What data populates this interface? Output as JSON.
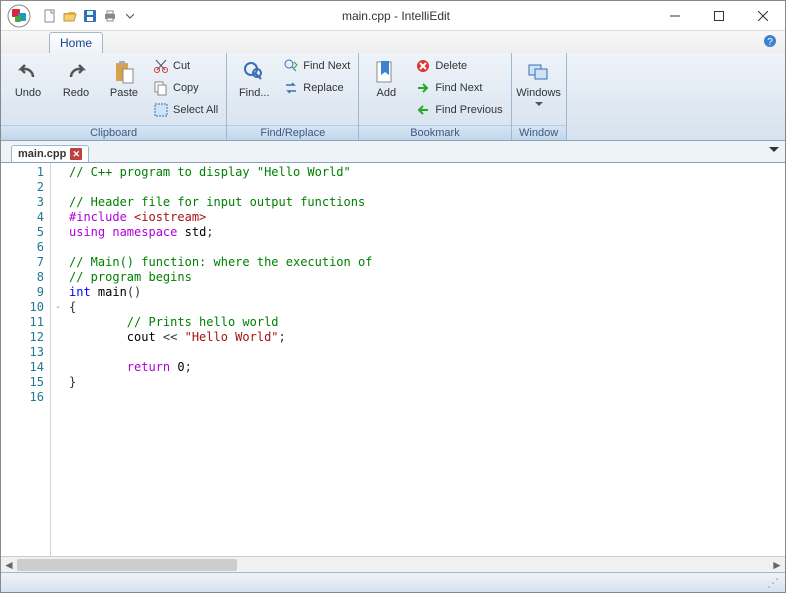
{
  "titlebar": {
    "title": "main.cpp - IntelliEdit"
  },
  "ribbon_tabs": {
    "home": "Home"
  },
  "ribbon": {
    "clipboard": {
      "label": "Clipboard",
      "undo": "Undo",
      "redo": "Redo",
      "paste": "Paste",
      "cut": "Cut",
      "copy": "Copy",
      "select_all": "Select All"
    },
    "find_replace": {
      "label": "Find/Replace",
      "find": "Find...",
      "find_next": "Find Next",
      "replace": "Replace"
    },
    "bookmark": {
      "label": "Bookmark",
      "add": "Add",
      "delete": "Delete",
      "find_next": "Find Next",
      "find_previous": "Find Previous"
    },
    "window": {
      "label": "Window",
      "windows": "Windows"
    }
  },
  "file_tab": {
    "name": "main.cpp"
  },
  "code": {
    "lines": [
      {
        "n": 1,
        "t": "comment",
        "text": "// C++ program to display \"Hello World\""
      },
      {
        "n": 2,
        "t": "blank",
        "text": ""
      },
      {
        "n": 3,
        "t": "comment",
        "text": "// Header file for input output functions"
      },
      {
        "n": 4,
        "t": "include",
        "text": "#include <iostream>"
      },
      {
        "n": 5,
        "t": "using",
        "text": "using namespace std;"
      },
      {
        "n": 6,
        "t": "blank",
        "text": ""
      },
      {
        "n": 7,
        "t": "comment",
        "text": "// Main() function: where the execution of"
      },
      {
        "n": 8,
        "t": "comment",
        "text": "// program begins"
      },
      {
        "n": 9,
        "t": "main_sig",
        "text": "int main()"
      },
      {
        "n": 10,
        "t": "brace_open",
        "text": "{",
        "fold": "-"
      },
      {
        "n": 11,
        "t": "comment_indent",
        "text": "        // Prints hello world"
      },
      {
        "n": 12,
        "t": "cout",
        "text": "        cout << \"Hello World\";"
      },
      {
        "n": 13,
        "t": "blank",
        "text": ""
      },
      {
        "n": 14,
        "t": "return",
        "text": "        return 0;"
      },
      {
        "n": 15,
        "t": "brace_close",
        "text": "}"
      },
      {
        "n": 16,
        "t": "blank",
        "text": ""
      }
    ]
  }
}
